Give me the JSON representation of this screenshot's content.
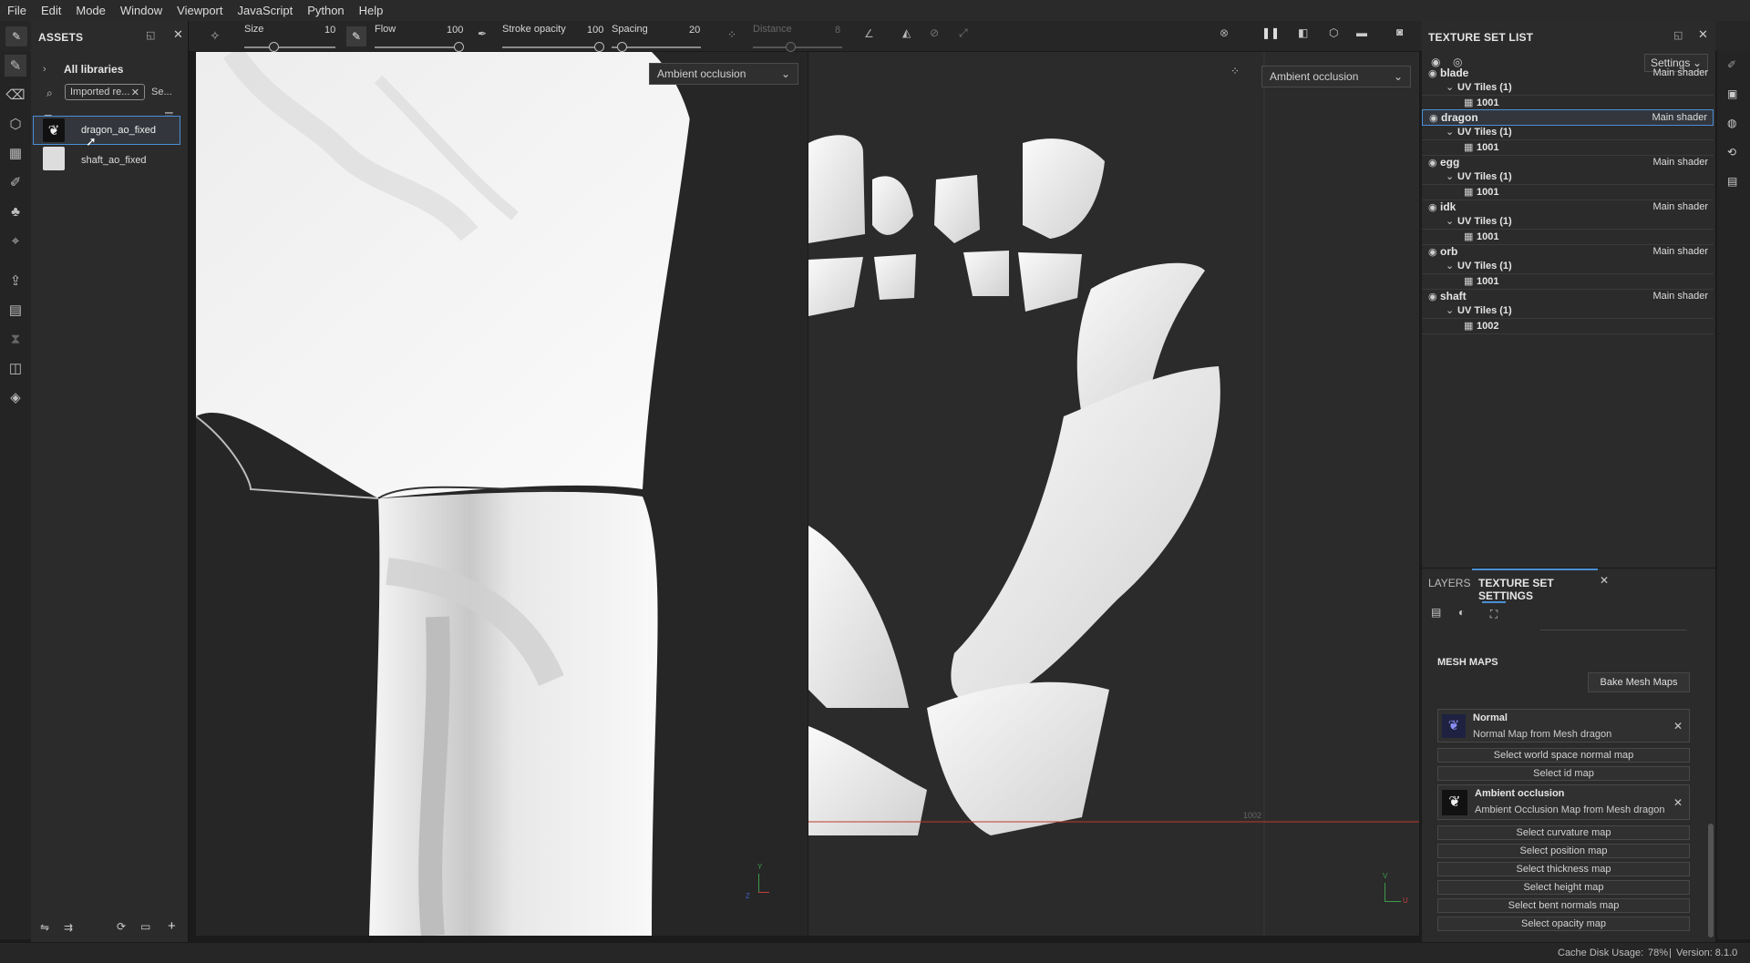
{
  "menu": [
    "File",
    "Edit",
    "Mode",
    "Window",
    "Viewport",
    "JavaScript",
    "Python",
    "Help"
  ],
  "toolbar": {
    "size": {
      "label": "Size",
      "value": "10"
    },
    "flow": {
      "label": "Flow",
      "value": "100"
    },
    "stroke_opacity": {
      "label": "Stroke opacity",
      "value": "100"
    },
    "spacing": {
      "label": "Spacing",
      "value": "20"
    },
    "distance": {
      "label": "Distance",
      "value": "8"
    }
  },
  "assets": {
    "title": "ASSETS",
    "breadcrumb": "All libraries",
    "search_value": "Imported re...",
    "search_more": "Se...",
    "items": [
      {
        "name": "dragon_ao_fixed",
        "selected": true
      },
      {
        "name": "shaft_ao_fixed",
        "selected": false
      }
    ]
  },
  "viewport": {
    "left_channel": "Ambient occlusion",
    "right_channel": "Ambient occlusion",
    "uv_label": "1002",
    "axis_3d": {
      "y": "Y",
      "z": "Z"
    },
    "axis_2d": {
      "v": "V",
      "u": "U"
    }
  },
  "texture_set_list": {
    "title": "TEXTURE SET LIST",
    "settings_label": "Settings",
    "sets": [
      {
        "name": "blade",
        "shader": "Main shader",
        "uv": "UV Tiles (1)",
        "tile": "1001",
        "selected": false
      },
      {
        "name": "dragon",
        "shader": "Main shader",
        "uv": "UV Tiles (1)",
        "tile": "1001",
        "selected": true
      },
      {
        "name": "egg",
        "shader": "Main shader",
        "uv": "UV Tiles (1)",
        "tile": "1001",
        "selected": false
      },
      {
        "name": "idk",
        "shader": "Main shader",
        "uv": "UV Tiles (1)",
        "tile": "1001",
        "selected": false
      },
      {
        "name": "orb",
        "shader": "Main shader",
        "uv": "UV Tiles (1)",
        "tile": "1001",
        "selected": false
      },
      {
        "name": "shaft",
        "shader": "Main shader",
        "uv": "UV Tiles (1)",
        "tile": "1002",
        "selected": false
      }
    ]
  },
  "texture_set_settings": {
    "tab_layers": "LAYERS",
    "tab_settings": "TEXTURE SET SETTINGS",
    "section": "MESH MAPS",
    "bake_button": "Bake Mesh Maps",
    "maps": [
      {
        "title": "Normal",
        "subtitle": "Normal Map from Mesh dragon"
      },
      {
        "title": "Ambient occlusion",
        "subtitle": "Ambient Occlusion Map from Mesh dragon"
      }
    ],
    "select_after_normal": [
      "Select world space normal map",
      "Select id map"
    ],
    "select_after_ao": [
      "Select curvature map",
      "Select position map",
      "Select thickness map",
      "Select height map",
      "Select bent normals map",
      "Select opacity map"
    ]
  },
  "status": {
    "cache": "Cache Disk Usage:",
    "cache_value": "78%",
    "version": "Version: 8.1.0"
  },
  "colors": {
    "accent": "#4a8fd6",
    "uv_line": "#c0392b"
  }
}
